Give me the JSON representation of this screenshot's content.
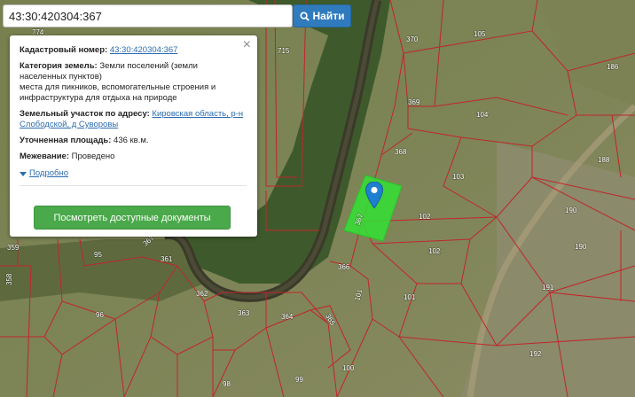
{
  "search": {
    "value": "43:30:420304:367",
    "button_label": "Найти",
    "button_icon": "search-icon"
  },
  "popup": {
    "cadastral_label": "Кадастровый номер:",
    "cadastral_value": "43:30:420304:367",
    "category_label": "Категория земель:",
    "category_value": "Земли поселений (земли населенных пунктов)",
    "purpose_value": "места для пикников, вспомогательные строения и инфраструктура для отдыха на природе",
    "address_label": "Земельный участок по адресу:",
    "address_value": "Кировская область, р-н Слободской, д Суворовы",
    "area_label": "Уточненная площадь:",
    "area_value": "436 кв.м.",
    "survey_label": "Межевание:",
    "survey_value": "Проведено",
    "details_label": "Подробно",
    "docs_button_label": "Посмотреть доступные документы",
    "close_icon": "close-icon"
  },
  "map": {
    "parcel_labels": [
      "370",
      "105",
      "715",
      "186",
      "369",
      "104",
      "368",
      "103",
      "188",
      "102",
      "190",
      "102",
      "190",
      "359",
      "95",
      "361",
      "366",
      "191",
      "101",
      "101",
      "362",
      "96",
      "363",
      "364",
      "365",
      "100",
      "192",
      "98",
      "99",
      "358",
      "774",
      "367",
      "367"
    ],
    "colors": {
      "boundary": "#c0262b",
      "selected_fill": "#33e033",
      "marker": "#1f7fd1"
    }
  }
}
